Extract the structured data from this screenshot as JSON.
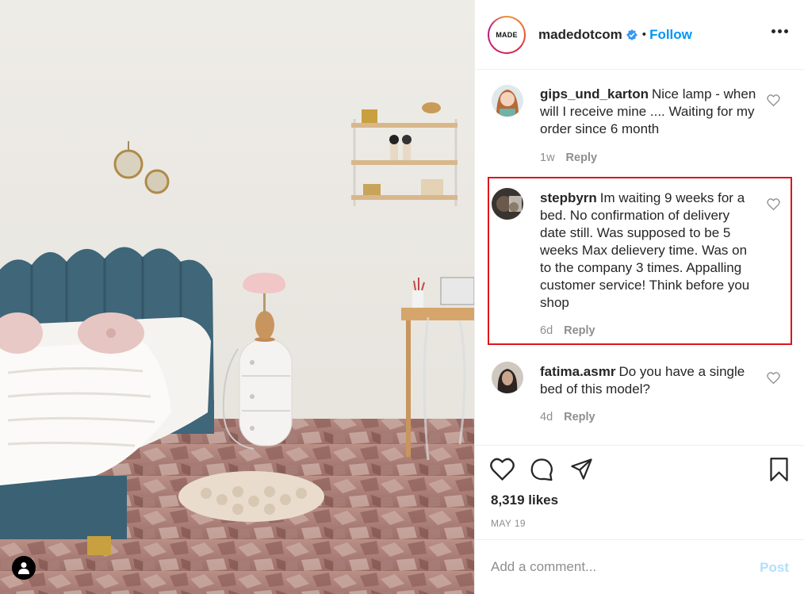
{
  "post": {
    "brand_logo_text": "MADE",
    "username": "madedotcom",
    "verified": true,
    "separator": "•",
    "follow_label": "Follow",
    "more_icon": "more-horizontal-icon"
  },
  "comments": [
    {
      "username": "gips_und_karton",
      "text": "Nice lamp - when will I receive mine .... Waiting for my order since 6 month",
      "age": "1w",
      "reply_label": "Reply"
    },
    {
      "username": "stepbyrn",
      "text": "Im waiting 9 weeks for a bed. No confirmation of delivery date still. Was supposed to be 5 weeks Max delievery time. Was on to the company 3 times. Appalling customer service! Think before you shop",
      "age": "6d",
      "reply_label": "Reply",
      "highlighted": true
    },
    {
      "username": "fatima.asmr",
      "text": "Do you have a single bed of this model?",
      "age": "4d",
      "reply_label": "Reply"
    }
  ],
  "actions": {
    "icons": [
      "heart-icon",
      "comment-icon",
      "share-icon",
      "bookmark-icon"
    ],
    "likes": "8,319 likes",
    "date": "MAY 19"
  },
  "add_comment": {
    "placeholder": "Add a comment...",
    "post_label": "Post"
  },
  "colors": {
    "link_blue": "#0095f6",
    "post_disabled": "#b2dffc",
    "highlight_red": "#e0141b",
    "muted": "#8e8e8e"
  }
}
